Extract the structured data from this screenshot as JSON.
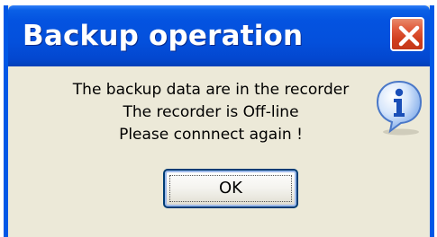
{
  "dialog": {
    "title": "Backup operation",
    "message_lines": [
      "The backup data are in the recorder",
      "The recorder is Off-line",
      "Please connnect again !"
    ],
    "ok_label": "OK",
    "icon": "info-icon",
    "close_icon": "close-icon"
  },
  "colors": {
    "titlebar": "#0453e0",
    "window_bg": "#ece9d8",
    "close_button": "#e0593a",
    "button_border": "#003c74"
  }
}
